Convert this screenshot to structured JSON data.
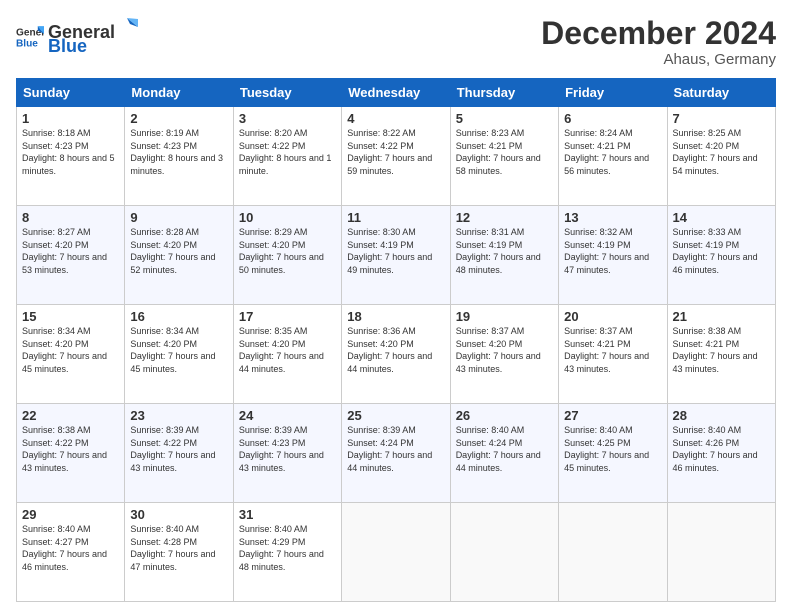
{
  "header": {
    "logo_general": "General",
    "logo_blue": "Blue",
    "month_title": "December 2024",
    "location": "Ahaus, Germany"
  },
  "columns": [
    "Sunday",
    "Monday",
    "Tuesday",
    "Wednesday",
    "Thursday",
    "Friday",
    "Saturday"
  ],
  "weeks": [
    [
      {
        "day": "1",
        "sunrise": "Sunrise: 8:18 AM",
        "sunset": "Sunset: 4:23 PM",
        "daylight": "Daylight: 8 hours and 5 minutes."
      },
      {
        "day": "2",
        "sunrise": "Sunrise: 8:19 AM",
        "sunset": "Sunset: 4:23 PM",
        "daylight": "Daylight: 8 hours and 3 minutes."
      },
      {
        "day": "3",
        "sunrise": "Sunrise: 8:20 AM",
        "sunset": "Sunset: 4:22 PM",
        "daylight": "Daylight: 8 hours and 1 minute."
      },
      {
        "day": "4",
        "sunrise": "Sunrise: 8:22 AM",
        "sunset": "Sunset: 4:22 PM",
        "daylight": "Daylight: 7 hours and 59 minutes."
      },
      {
        "day": "5",
        "sunrise": "Sunrise: 8:23 AM",
        "sunset": "Sunset: 4:21 PM",
        "daylight": "Daylight: 7 hours and 58 minutes."
      },
      {
        "day": "6",
        "sunrise": "Sunrise: 8:24 AM",
        "sunset": "Sunset: 4:21 PM",
        "daylight": "Daylight: 7 hours and 56 minutes."
      },
      {
        "day": "7",
        "sunrise": "Sunrise: 8:25 AM",
        "sunset": "Sunset: 4:20 PM",
        "daylight": "Daylight: 7 hours and 54 minutes."
      }
    ],
    [
      {
        "day": "8",
        "sunrise": "Sunrise: 8:27 AM",
        "sunset": "Sunset: 4:20 PM",
        "daylight": "Daylight: 7 hours and 53 minutes."
      },
      {
        "day": "9",
        "sunrise": "Sunrise: 8:28 AM",
        "sunset": "Sunset: 4:20 PM",
        "daylight": "Daylight: 7 hours and 52 minutes."
      },
      {
        "day": "10",
        "sunrise": "Sunrise: 8:29 AM",
        "sunset": "Sunset: 4:20 PM",
        "daylight": "Daylight: 7 hours and 50 minutes."
      },
      {
        "day": "11",
        "sunrise": "Sunrise: 8:30 AM",
        "sunset": "Sunset: 4:19 PM",
        "daylight": "Daylight: 7 hours and 49 minutes."
      },
      {
        "day": "12",
        "sunrise": "Sunrise: 8:31 AM",
        "sunset": "Sunset: 4:19 PM",
        "daylight": "Daylight: 7 hours and 48 minutes."
      },
      {
        "day": "13",
        "sunrise": "Sunrise: 8:32 AM",
        "sunset": "Sunset: 4:19 PM",
        "daylight": "Daylight: 7 hours and 47 minutes."
      },
      {
        "day": "14",
        "sunrise": "Sunrise: 8:33 AM",
        "sunset": "Sunset: 4:19 PM",
        "daylight": "Daylight: 7 hours and 46 minutes."
      }
    ],
    [
      {
        "day": "15",
        "sunrise": "Sunrise: 8:34 AM",
        "sunset": "Sunset: 4:20 PM",
        "daylight": "Daylight: 7 hours and 45 minutes."
      },
      {
        "day": "16",
        "sunrise": "Sunrise: 8:34 AM",
        "sunset": "Sunset: 4:20 PM",
        "daylight": "Daylight: 7 hours and 45 minutes."
      },
      {
        "day": "17",
        "sunrise": "Sunrise: 8:35 AM",
        "sunset": "Sunset: 4:20 PM",
        "daylight": "Daylight: 7 hours and 44 minutes."
      },
      {
        "day": "18",
        "sunrise": "Sunrise: 8:36 AM",
        "sunset": "Sunset: 4:20 PM",
        "daylight": "Daylight: 7 hours and 44 minutes."
      },
      {
        "day": "19",
        "sunrise": "Sunrise: 8:37 AM",
        "sunset": "Sunset: 4:20 PM",
        "daylight": "Daylight: 7 hours and 43 minutes."
      },
      {
        "day": "20",
        "sunrise": "Sunrise: 8:37 AM",
        "sunset": "Sunset: 4:21 PM",
        "daylight": "Daylight: 7 hours and 43 minutes."
      },
      {
        "day": "21",
        "sunrise": "Sunrise: 8:38 AM",
        "sunset": "Sunset: 4:21 PM",
        "daylight": "Daylight: 7 hours and 43 minutes."
      }
    ],
    [
      {
        "day": "22",
        "sunrise": "Sunrise: 8:38 AM",
        "sunset": "Sunset: 4:22 PM",
        "daylight": "Daylight: 7 hours and 43 minutes."
      },
      {
        "day": "23",
        "sunrise": "Sunrise: 8:39 AM",
        "sunset": "Sunset: 4:22 PM",
        "daylight": "Daylight: 7 hours and 43 minutes."
      },
      {
        "day": "24",
        "sunrise": "Sunrise: 8:39 AM",
        "sunset": "Sunset: 4:23 PM",
        "daylight": "Daylight: 7 hours and 43 minutes."
      },
      {
        "day": "25",
        "sunrise": "Sunrise: 8:39 AM",
        "sunset": "Sunset: 4:24 PM",
        "daylight": "Daylight: 7 hours and 44 minutes."
      },
      {
        "day": "26",
        "sunrise": "Sunrise: 8:40 AM",
        "sunset": "Sunset: 4:24 PM",
        "daylight": "Daylight: 7 hours and 44 minutes."
      },
      {
        "day": "27",
        "sunrise": "Sunrise: 8:40 AM",
        "sunset": "Sunset: 4:25 PM",
        "daylight": "Daylight: 7 hours and 45 minutes."
      },
      {
        "day": "28",
        "sunrise": "Sunrise: 8:40 AM",
        "sunset": "Sunset: 4:26 PM",
        "daylight": "Daylight: 7 hours and 46 minutes."
      }
    ],
    [
      {
        "day": "29",
        "sunrise": "Sunrise: 8:40 AM",
        "sunset": "Sunset: 4:27 PM",
        "daylight": "Daylight: 7 hours and 46 minutes."
      },
      {
        "day": "30",
        "sunrise": "Sunrise: 8:40 AM",
        "sunset": "Sunset: 4:28 PM",
        "daylight": "Daylight: 7 hours and 47 minutes."
      },
      {
        "day": "31",
        "sunrise": "Sunrise: 8:40 AM",
        "sunset": "Sunset: 4:29 PM",
        "daylight": "Daylight: 7 hours and 48 minutes."
      },
      null,
      null,
      null,
      null
    ]
  ]
}
